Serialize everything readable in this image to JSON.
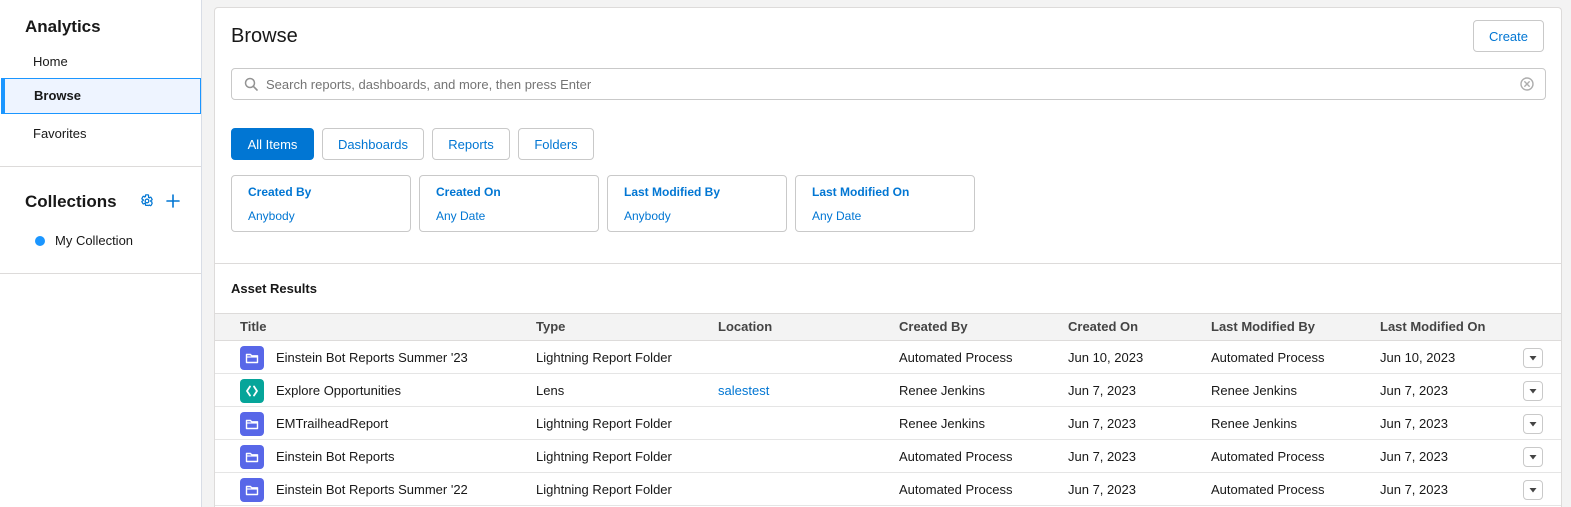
{
  "sidebar": {
    "app_title": "Analytics",
    "nav": [
      {
        "label": "Home"
      },
      {
        "label": "Browse"
      },
      {
        "label": "Favorites"
      }
    ],
    "collections_title": "Collections",
    "collections": [
      {
        "label": "My Collection",
        "color": "#1b96ff"
      }
    ]
  },
  "main": {
    "title": "Browse",
    "create_label": "Create",
    "search_placeholder": "Search reports, dashboards, and more, then press Enter",
    "search_value": "",
    "tabs": [
      {
        "label": "All Items",
        "active": true
      },
      {
        "label": "Dashboards",
        "active": false
      },
      {
        "label": "Reports",
        "active": false
      },
      {
        "label": "Folders",
        "active": false
      }
    ],
    "filters": [
      {
        "label": "Created By",
        "value": "Anybody"
      },
      {
        "label": "Created On",
        "value": "Any Date"
      },
      {
        "label": "Last Modified By",
        "value": "Anybody"
      },
      {
        "label": "Last Modified On",
        "value": "Any Date"
      }
    ],
    "results_title": "Asset Results",
    "columns": [
      "Title",
      "Type",
      "Location",
      "Created By",
      "Created On",
      "Last Modified By",
      "Last Modified On"
    ],
    "rows": [
      {
        "icon": "folder-icon",
        "title": "Einstein Bot Reports Summer '23",
        "type": "Lightning Report Folder",
        "location": "",
        "created_by": "Automated Process",
        "created_on": "Jun 10, 2023",
        "last_modified_by": "Automated Process",
        "last_modified_on": "Jun 10, 2023"
      },
      {
        "icon": "lens-icon",
        "title": "Explore Opportunities",
        "type": "Lens",
        "location": "salestest",
        "created_by": "Renee Jenkins",
        "created_on": "Jun 7, 2023",
        "last_modified_by": "Renee Jenkins",
        "last_modified_on": "Jun 7, 2023"
      },
      {
        "icon": "folder-icon",
        "title": "EMTrailheadReport",
        "type": "Lightning Report Folder",
        "location": "",
        "created_by": "Renee Jenkins",
        "created_on": "Jun 7, 2023",
        "last_modified_by": "Renee Jenkins",
        "last_modified_on": "Jun 7, 2023"
      },
      {
        "icon": "folder-icon",
        "title": "Einstein Bot Reports",
        "type": "Lightning Report Folder",
        "location": "",
        "created_by": "Automated Process",
        "created_on": "Jun 7, 2023",
        "last_modified_by": "Automated Process",
        "last_modified_on": "Jun 7, 2023"
      },
      {
        "icon": "folder-icon",
        "title": "Einstein Bot Reports Summer '22",
        "type": "Lightning Report Folder",
        "location": "",
        "created_by": "Automated Process",
        "created_on": "Jun 7, 2023",
        "last_modified_by": "Automated Process",
        "last_modified_on": "Jun 7, 2023"
      }
    ]
  },
  "colors": {
    "brand": "#0176d3",
    "folder_icon_bg": "#5867e8",
    "lens_icon_bg": "#06a59a",
    "selected_nav_bg": "#eef4ff"
  }
}
